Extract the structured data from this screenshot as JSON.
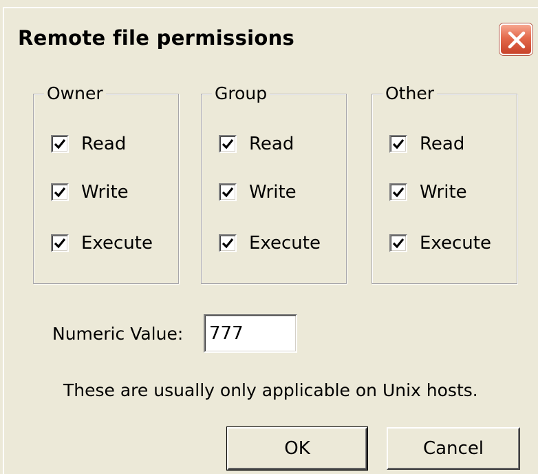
{
  "window": {
    "title": "Remote file permissions"
  },
  "groups": [
    {
      "id": "owner",
      "legend": "Owner",
      "checkboxes": [
        {
          "label": "Read",
          "checked": true
        },
        {
          "label": "Write",
          "checked": true
        },
        {
          "label": "Execute",
          "checked": true
        }
      ]
    },
    {
      "id": "group",
      "legend": "Group",
      "checkboxes": [
        {
          "label": "Read",
          "checked": true
        },
        {
          "label": "Write",
          "checked": true
        },
        {
          "label": "Execute",
          "checked": true
        }
      ]
    },
    {
      "id": "other",
      "legend": "Other",
      "checkboxes": [
        {
          "label": "Read",
          "checked": true
        },
        {
          "label": "Write",
          "checked": true
        },
        {
          "label": "Execute",
          "checked": true
        }
      ]
    }
  ],
  "numeric": {
    "label": "Numeric Value:",
    "value": "777"
  },
  "note": "These are usually only applicable on Unix hosts.",
  "buttons": {
    "ok": "OK",
    "cancel": "Cancel"
  },
  "colors": {
    "background": "#ece9d8",
    "close_button": "#e46a4c"
  },
  "icons": {
    "close": "close-icon",
    "check": "checkmark-icon"
  }
}
